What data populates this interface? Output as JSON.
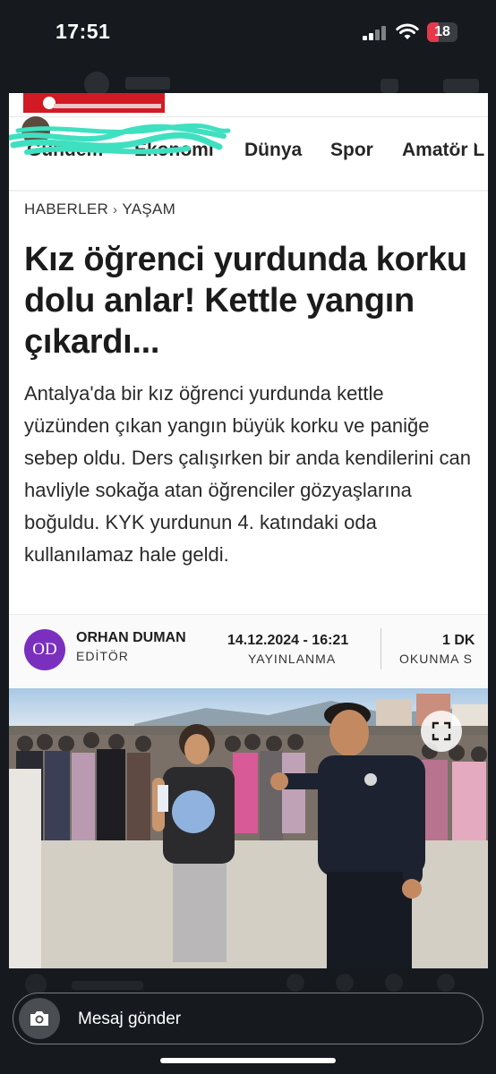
{
  "status_bar": {
    "time": "17:51",
    "battery": "18",
    "battery_color": "#e5384a"
  },
  "article": {
    "nav_items": [
      "Gündem",
      "Ekonomi",
      "Dünya",
      "Spor",
      "Amatör L"
    ],
    "breadcrumb": {
      "first": "HABERLER",
      "second": "YAŞAM"
    },
    "headline": "Kız öğrenci yurdunda korku dolu anlar! Kettle yangın çıkardı...",
    "lead": "Antalya'da bir kız öğrenci yurdunda kettle yüzünden çıkan yangın büyük korku ve paniğe sebep oldu. Ders çalışırken bir anda kendilerini can havliyle sokağa atan öğrenciler gözyaşlarına boğuldu. KYK yurdunun 4. katındaki oda kullanılamaz hale geldi.",
    "author": {
      "initials": "OD",
      "name": "ORHAN DUMAN",
      "role": "EDİTÖR",
      "avatar_color": "#7b2fbf"
    },
    "published": {
      "value": "14.12.2024 - 16:21",
      "label": "YAYINLANMA"
    },
    "reading": {
      "value": "1 DK",
      "label": "OKUNMA S"
    }
  },
  "reply_bar": {
    "placeholder": "Mesaj gönder"
  },
  "icons": {
    "close": "close-icon",
    "camera": "camera-icon",
    "expand": "expand-icon",
    "signal": "signal-icon",
    "wifi": "wifi-icon",
    "battery": "battery-icon"
  }
}
